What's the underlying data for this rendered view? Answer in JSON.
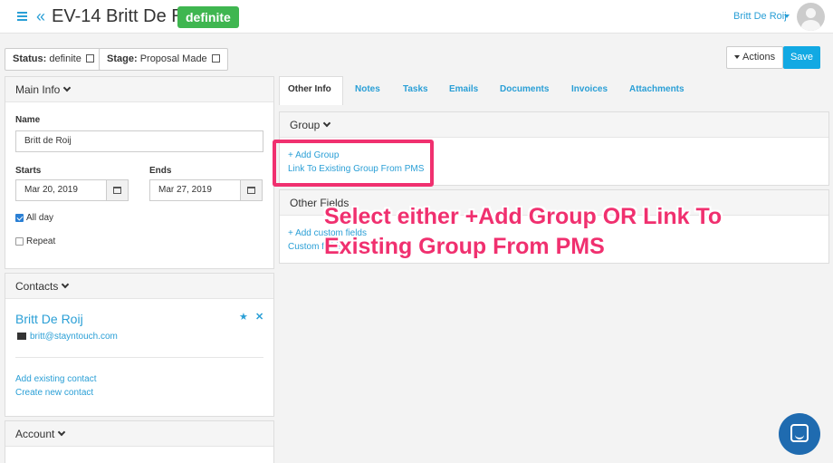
{
  "header": {
    "event_id_title": "EV-14 Britt De Roij",
    "badge": "definite",
    "user_name": "Britt De Roij"
  },
  "toolbar": {
    "status_label": "Status:",
    "status_value": "definite",
    "stage_label": "Stage:",
    "stage_value": "Proposal Made",
    "actions_label": "Actions",
    "save_label": "Save"
  },
  "main_info": {
    "heading": "Main Info",
    "name_label": "Name",
    "name_value": "Britt de Roij",
    "starts_label": "Starts",
    "starts_value": "Mar 20, 2019",
    "ends_label": "Ends",
    "ends_value": "Mar 27, 2019",
    "all_day_label": "All day",
    "all_day_checked": true,
    "repeat_label": "Repeat",
    "repeat_checked": false
  },
  "contacts": {
    "heading": "Contacts",
    "contact_name": "Britt De Roij",
    "contact_email": "britt@stayntouch.com",
    "add_existing": "Add existing contact",
    "create_new": "Create new contact"
  },
  "account": {
    "heading": "Account",
    "sub": "Account"
  },
  "tabs": [
    {
      "label": "Other Info",
      "active": true
    },
    {
      "label": "Notes"
    },
    {
      "label": "Tasks"
    },
    {
      "label": "Emails"
    },
    {
      "label": "Documents"
    },
    {
      "label": "Invoices"
    },
    {
      "label": "Attachments"
    }
  ],
  "group": {
    "heading": "Group",
    "add_group": "+ Add Group",
    "link_group": "Link To Existing Group From PMS"
  },
  "other_fields": {
    "heading": "Other Fields",
    "add_custom": "+ Add custom fields",
    "custom_link": "Custom fields"
  },
  "annotation": {
    "text": "Select either +Add Group OR Link To Existing Group From PMS"
  },
  "colors": {
    "accent": "#2a9fd6",
    "badge_green": "#3fb650",
    "save_blue": "#12a9e3",
    "annotation_pink": "#f0306f"
  },
  "icons": [
    "menu-icon",
    "back-chevrons-icon",
    "caret-down-icon",
    "edit-icon",
    "calendar-icon",
    "star-icon",
    "close-icon",
    "envelope-icon",
    "chat-icon"
  ]
}
